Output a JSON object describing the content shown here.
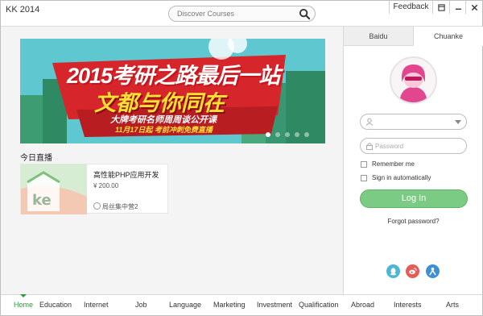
{
  "window": {
    "title": "KK 2014"
  },
  "search": {
    "placeholder": "Discover Courses"
  },
  "titlebar": {
    "feedback_label": "Feedback"
  },
  "banner": {
    "line1": "2015考研之路最后一站",
    "line2": "文都与你同在",
    "line3": "大牌考研名师周周谈公开课",
    "line4": "11月17日起 考前冲刺免费直播",
    "slide_count": 5,
    "active_slide": 1
  },
  "live": {
    "section_title": "今日直播",
    "course": {
      "title": "高性能PHP应用开发",
      "price": "¥ 200.00",
      "teacher": "局丝集中营2",
      "thumb_text": "ke"
    }
  },
  "login": {
    "tabs": [
      {
        "label": "Baidu"
      },
      {
        "label": "Chuanke"
      }
    ],
    "active_tab": "Chuanke",
    "username_placeholder": "",
    "password_placeholder": "Password",
    "remember_label": "Remember me",
    "auto_signin_label": "Sign in automatically",
    "login_button": "Log In",
    "forgot_label": "Forgot password?",
    "social_icons": [
      "qq-icon",
      "weibo-icon",
      "renren-icon"
    ]
  },
  "nav": {
    "items": [
      {
        "label": "Home"
      },
      {
        "label": "Education"
      },
      {
        "label": "Internet"
      },
      {
        "label": "Job"
      },
      {
        "label": "Language"
      },
      {
        "label": "Marketing"
      },
      {
        "label": "Investment"
      },
      {
        "label": "Qualification"
      },
      {
        "label": "Abroad"
      },
      {
        "label": "Interests"
      },
      {
        "label": "Arts"
      }
    ],
    "active": "Home"
  },
  "colors": {
    "accent_green": "#2a9a3a",
    "login_button": "#7ccb84",
    "avatar_pink": "#e2468f",
    "banner_teal": "#5ec7d0",
    "banner_red": "#d7262b"
  }
}
